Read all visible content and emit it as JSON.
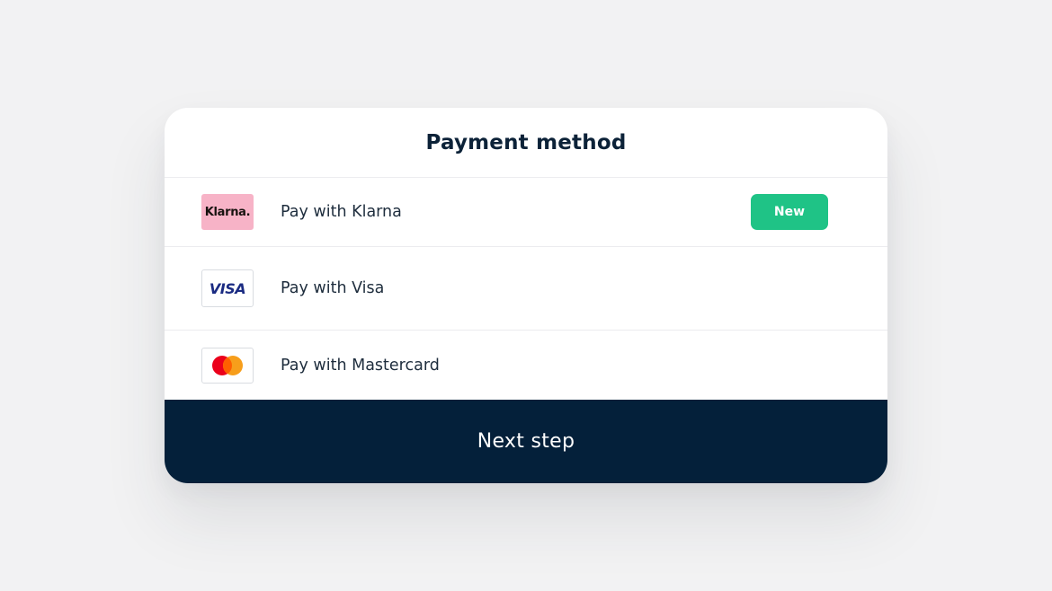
{
  "dialog": {
    "title": "Payment method"
  },
  "payment_methods": [
    {
      "label": "Pay with Klarna",
      "logo_text": "Klarna.",
      "logo_color": "#f7b3c7",
      "badge": "New",
      "badge_color": "#1fc386"
    },
    {
      "label": "Pay with Visa",
      "logo_text": "VISA",
      "logo_color": "#1a2b82"
    },
    {
      "label": "Pay with Mastercard",
      "logo_icon": "mastercard-icon",
      "logo_colors": [
        "#eb001b",
        "#f79e1b"
      ]
    }
  ],
  "footer": {
    "next_label": "Next step",
    "background": "#04203a"
  }
}
